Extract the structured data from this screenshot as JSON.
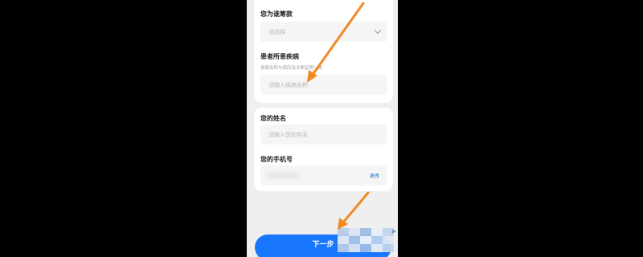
{
  "form": {
    "fundraise_for": {
      "label": "您为谁筹款",
      "placeholder": "请选择"
    },
    "disease": {
      "label": "患者所患疾病",
      "hint": "疾病名称与病历及诊断证明一致",
      "placeholder": "请输入疾病名称"
    },
    "name": {
      "label": "您的姓名",
      "placeholder": "请输入您的姓名"
    },
    "phone": {
      "label": "您的手机号",
      "change_label": "更改"
    }
  },
  "footer": {
    "next_label": "下一步"
  },
  "annotations": {
    "arrow_color": "#f08a24"
  },
  "colors": {
    "primary_button": "#1976ff",
    "link": "#1a6fc9"
  }
}
